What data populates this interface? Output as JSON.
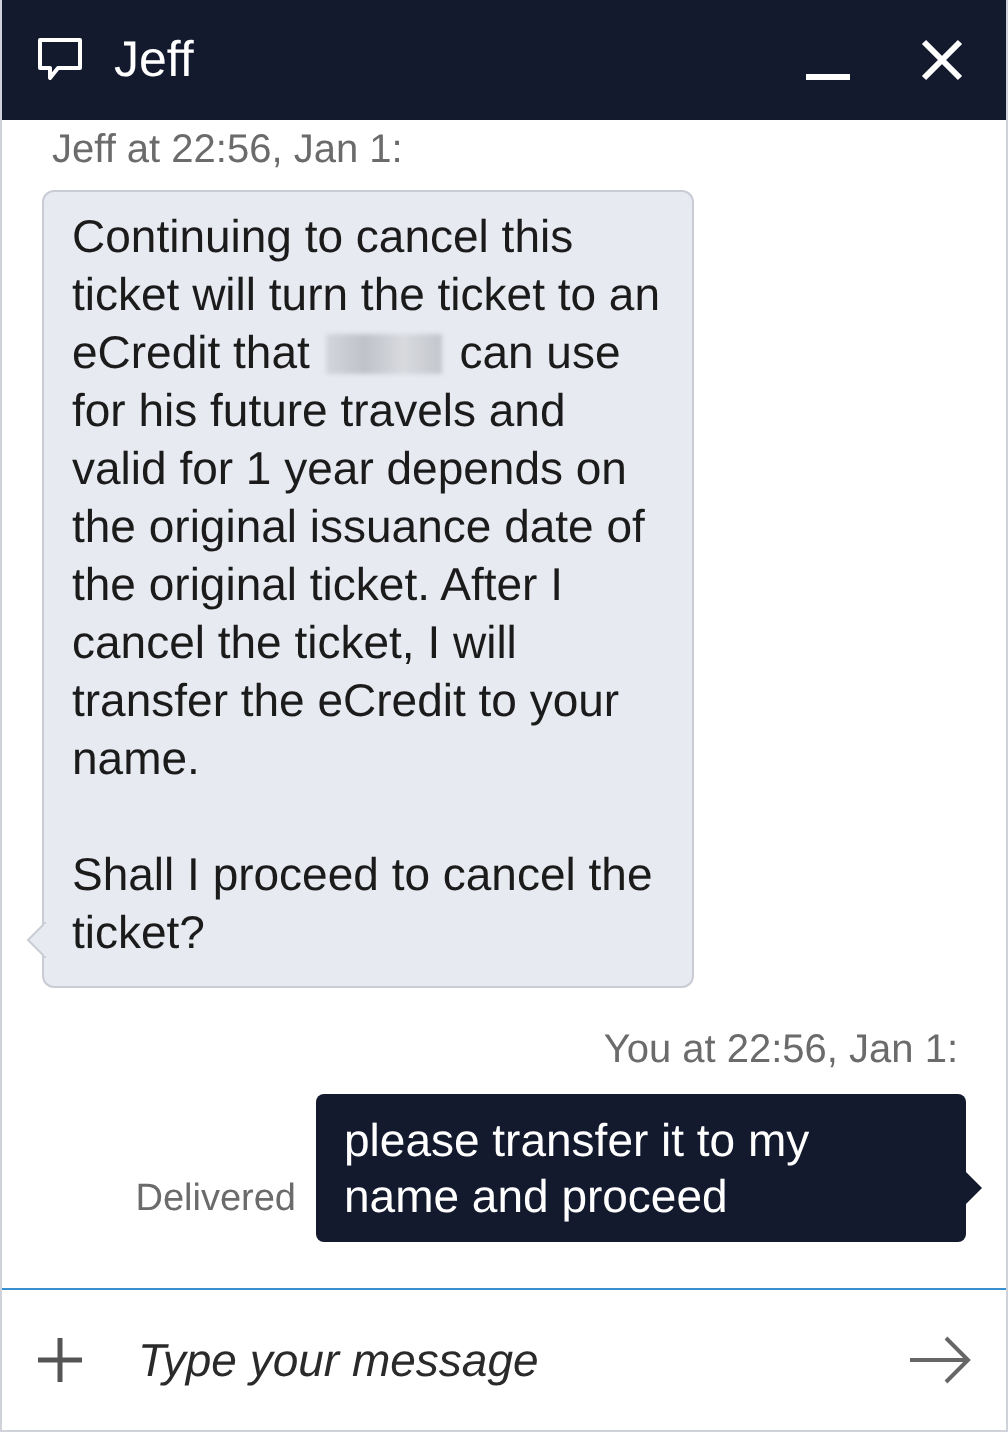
{
  "window": {
    "title": "Jeff"
  },
  "messages": [
    {
      "kind": "incoming",
      "meta": "Jeff at 22:56, Jan 1:",
      "paragraphs": [
        [
          {
            "kind": "text",
            "text": "Continuing to cancel this ticket will turn the ticket to an eCredit that"
          },
          {
            "kind": "redacted"
          },
          {
            "kind": "text",
            "text": "can use for his future travels and valid for 1 year depends on the original issuance date of the original ticket. After I cancel the ticket, I will transfer the eCredit to your name."
          }
        ],
        [
          {
            "kind": "text",
            "text": "Shall I proceed to cancel the ticket?"
          }
        ]
      ]
    },
    {
      "kind": "outgoing",
      "meta": "You at 22:56, Jan 1:",
      "status": "Delivered",
      "paragraphs": [
        [
          {
            "kind": "text",
            "text": "please transfer it to my name and proceed"
          }
        ]
      ]
    }
  ],
  "composer": {
    "placeholder": "Type your message"
  }
}
